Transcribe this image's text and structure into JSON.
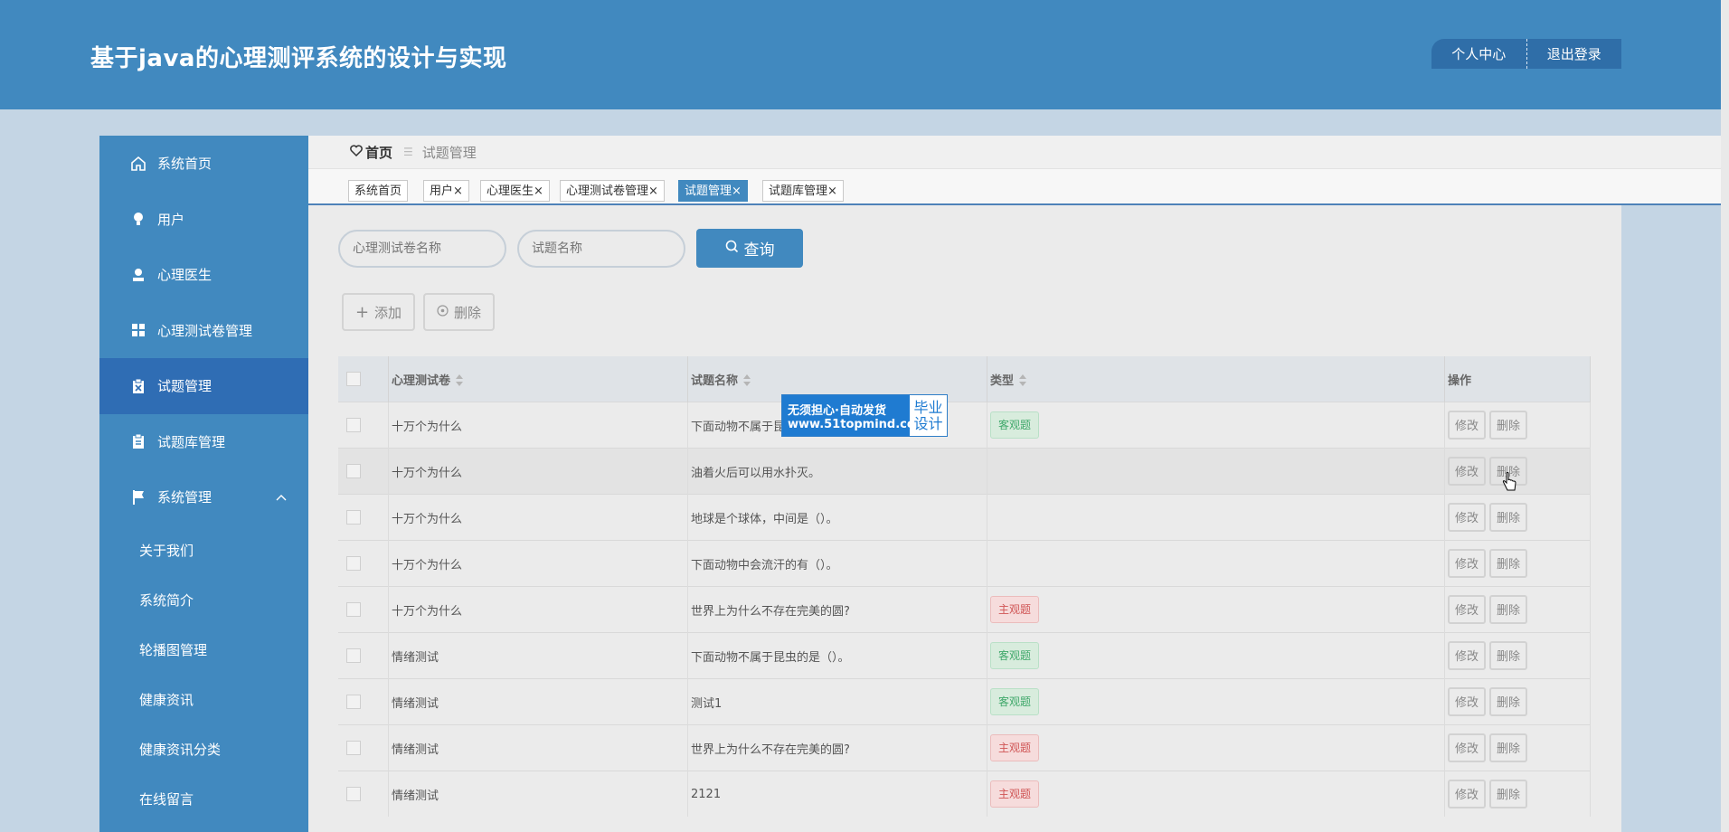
{
  "header": {
    "title": "基于java的心理测评系统的设计与实现",
    "profile_label": "个人中心",
    "logout_label": "退出登录"
  },
  "sidebar": {
    "items": [
      {
        "label": "系统首页",
        "icon": "home-icon"
      },
      {
        "label": "用户",
        "icon": "bulb-icon"
      },
      {
        "label": "心理医生",
        "icon": "user-icon"
      },
      {
        "label": "心理测试卷管理",
        "icon": "grid-icon"
      },
      {
        "label": "试题管理",
        "icon": "clipboard-x-icon",
        "active": true
      },
      {
        "label": "试题库管理",
        "icon": "clipboard-icon"
      },
      {
        "label": "系统管理",
        "icon": "flag-icon",
        "expanded": true
      }
    ],
    "sub_items": [
      "关于我们",
      "系统简介",
      "轮播图管理",
      "健康资讯",
      "健康资讯分类",
      "在线留言"
    ]
  },
  "breadcrumb": {
    "home": "首页",
    "current": "试题管理"
  },
  "tabs": [
    {
      "label": "系统首页"
    },
    {
      "label": "用户",
      "close": "×"
    },
    {
      "label": "心理医生",
      "close": "×"
    },
    {
      "label": "心理测试卷管理",
      "close": "×"
    },
    {
      "label": "试题管理",
      "close": "×",
      "active": true
    },
    {
      "label": "试题库管理",
      "close": "×"
    }
  ],
  "search": {
    "paper_placeholder": "心理测试卷名称",
    "question_placeholder": "试题名称",
    "query_label": "查询"
  },
  "actions": {
    "add_label": "添加",
    "delete_label": "删除"
  },
  "table": {
    "columns": [
      "心理测试卷",
      "试题名称",
      "类型",
      "操作"
    ],
    "edit_label": "修改",
    "delete_label": "删除",
    "rows": [
      {
        "paper": "十万个为什么",
        "question": "下面动物不属于昆",
        "type": "客观题"
      },
      {
        "paper": "十万个为什么",
        "question": "油着火后可以用水扑灭。",
        "type": ""
      },
      {
        "paper": "十万个为什么",
        "question": "地球是个球体，中间是（）。",
        "type": ""
      },
      {
        "paper": "十万个为什么",
        "question": "下面动物中会流汗的有（）。",
        "type": ""
      },
      {
        "paper": "十万个为什么",
        "question": "世界上为什么不存在完美的圆?",
        "type": "主观题"
      },
      {
        "paper": "情绪测试",
        "question": "下面动物不属于昆虫的是（）。",
        "type": "客观题"
      },
      {
        "paper": "情绪测试",
        "question": "测试1",
        "type": "客观题"
      },
      {
        "paper": "情绪测试",
        "question": "世界上为什么不存在完美的圆?",
        "type": "主观题"
      },
      {
        "paper": "情绪测试",
        "question": "2121",
        "type": "主观题"
      }
    ]
  },
  "watermark": {
    "line1": "无须担心·自动发货",
    "line2": "www.51topmind.com",
    "right1": "毕业",
    "right2": "设计"
  },
  "colors": {
    "primary": "#4189bf",
    "active_menu": "#2f6db4",
    "objective": "#3fa86a",
    "subjective": "#d05555"
  }
}
